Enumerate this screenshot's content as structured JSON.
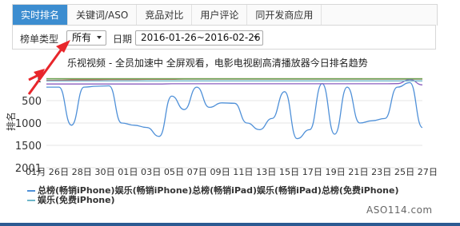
{
  "tabs": [
    {
      "label": "实时排名",
      "active": true
    },
    {
      "label": "关键词/ASO",
      "active": false
    },
    {
      "label": "竞品对比",
      "active": false
    },
    {
      "label": "用户评论",
      "active": false
    },
    {
      "label": "同开发商应用",
      "active": false
    }
  ],
  "filter": {
    "list_type_label": "榜单类型",
    "list_type_value": "所有",
    "date_label": "日期",
    "date_value": "2016-01-26~2016-02-26"
  },
  "chart_title": "乐视视频 - 全员加速中 全屏观看，电影电视剧高清播放器今日排名趋势",
  "watermark": "ASO114.com",
  "colors": {
    "accent": "#3c8dd0",
    "annotation_arrow": "#e8262b",
    "footer": "#2c5a92"
  },
  "chart_data": {
    "type": "line",
    "yaxis": {
      "reversed": true,
      "ylim": [
        1,
        2000
      ],
      "ticks": [
        "1",
        "500",
        "1000",
        "1500",
        "2001"
      ]
    },
    "x_tick_labels": [
      "01月26日",
      "01月28日",
      "01月30日",
      "02月01日",
      "02月03日",
      "02月05日",
      "02月07日",
      "02月09日",
      "02月11日",
      "02月13日",
      "02月15日",
      "02月17日",
      "02月19日",
      "02月21日",
      "02月23日",
      "02月25日",
      "02月27日"
    ],
    "x_tick_display": "01月 26日 28日 30日 01日 03日 05日 07日 09日 11日 13日 15日 17日 19日 21日 23日 25日 27日",
    "series": [
      {
        "name": "总榜(畅销iPhone)",
        "color": "#4f90d8",
        "values": [
          200,
          200,
          1050,
          200,
          180,
          170,
          1000,
          1050,
          1100,
          1300,
          400,
          700,
          200,
          650,
          550,
          560,
          1000,
          1150,
          900,
          300,
          1350,
          1150,
          120,
          1250,
          200,
          1000,
          950,
          900,
          200,
          100,
          1100
        ]
      },
      {
        "name": "娱乐(畅销iPhone)",
        "color": "#e06060",
        "values": [
          50,
          45,
          40,
          40,
          35,
          30,
          30,
          30,
          25,
          25,
          25,
          20,
          20,
          20,
          20,
          20,
          20,
          20,
          20,
          20,
          20,
          20,
          20,
          20,
          20,
          20,
          20,
          20,
          20,
          20,
          20
        ]
      },
      {
        "name": "总榜(畅销iPad)",
        "color": "#8b5fbf",
        "values": [
          130,
          130,
          130,
          130,
          130,
          130,
          130,
          130,
          130,
          130,
          125,
          125,
          125,
          125,
          125,
          125,
          125,
          125,
          125,
          125,
          125,
          125,
          125,
          125,
          125,
          125,
          125,
          125,
          120,
          30,
          150
        ]
      },
      {
        "name": "娱乐(畅销iPad)",
        "color": "#d3a84a",
        "values": [
          10,
          10,
          10,
          10,
          10,
          10,
          10,
          10,
          10,
          10,
          10,
          10,
          10,
          10,
          10,
          10,
          10,
          10,
          10,
          10,
          10,
          10,
          10,
          10,
          10,
          10,
          10,
          10,
          10,
          10,
          10
        ]
      },
      {
        "name": "总榜(免费iPhone)",
        "color": "#5aa55a",
        "values": [
          15,
          15,
          15,
          15,
          15,
          15,
          15,
          15,
          15,
          15,
          15,
          15,
          15,
          15,
          15,
          15,
          15,
          15,
          15,
          15,
          15,
          15,
          15,
          15,
          15,
          15,
          15,
          15,
          15,
          15,
          15
        ]
      },
      {
        "name": "娱乐(免费iPhone)",
        "color": "#6fb6c9",
        "values": [
          60,
          60,
          60,
          60,
          60,
          60,
          60,
          60,
          60,
          60,
          60,
          60,
          60,
          60,
          60,
          60,
          60,
          60,
          60,
          60,
          60,
          60,
          60,
          60,
          60,
          60,
          60,
          60,
          60,
          60,
          60
        ]
      }
    ],
    "legend_placement": "bottom"
  }
}
